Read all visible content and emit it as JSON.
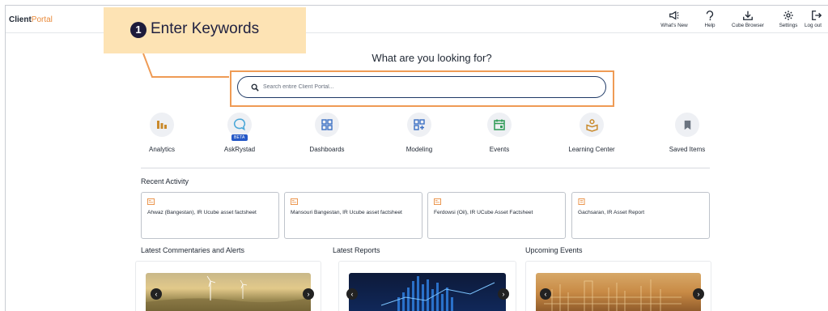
{
  "app": {
    "logo_bold": "Client",
    "logo_light": "Portal"
  },
  "topnav": [
    {
      "label": "What's New",
      "icon": "megaphone-icon"
    },
    {
      "label": "Help",
      "icon": "help-icon"
    },
    {
      "label": "Cube Browser",
      "icon": "download-icon"
    },
    {
      "label": "Settings",
      "icon": "gear-icon"
    },
    {
      "label": "Log out",
      "icon": "logout-icon"
    }
  ],
  "callout": {
    "number": "1",
    "text": "Enter Keywords",
    "bg_color": "#fde3b4",
    "border_color": "#ef9b55"
  },
  "main": {
    "heading": "What are you looking for?",
    "search_placeholder": "Search entire Client Portal..."
  },
  "quick_links": [
    {
      "label": "Analytics",
      "icon": "analytics-icon"
    },
    {
      "label": "AskRystad",
      "icon": "chat-bubble-icon",
      "badge": "BETA"
    },
    {
      "label": "Dashboards",
      "icon": "dashboard-icon"
    },
    {
      "label": "Modeling",
      "icon": "modeling-icon"
    },
    {
      "label": "Events",
      "icon": "calendar-icon"
    },
    {
      "label": "Learning Center",
      "icon": "learning-icon"
    },
    {
      "label": "Saved Items",
      "icon": "bookmark-icon"
    }
  ],
  "recent_activity": {
    "title": "Recent Activity",
    "items": [
      {
        "text": "Ahwaz (Bangestan), IR Ucube asset factsheet",
        "icon": "factsheet-icon"
      },
      {
        "text": "Mansouri Bangestan, IR Ucube asset factsheet",
        "icon": "factsheet-icon"
      },
      {
        "text": "Ferdowsi (Oil), IR UCube Asset Factsheet",
        "icon": "factsheet-icon"
      },
      {
        "text": "Gachsaran, IR Asset Report",
        "icon": "report-icon"
      }
    ]
  },
  "sections": {
    "commentaries": "Latest Commentaries and Alerts",
    "reports": "Latest Reports",
    "events": "Upcoming Events"
  },
  "colors": {
    "accent": "#e98b3c",
    "navy": "#1f3a66",
    "icon_bg": "#eef0f4"
  }
}
